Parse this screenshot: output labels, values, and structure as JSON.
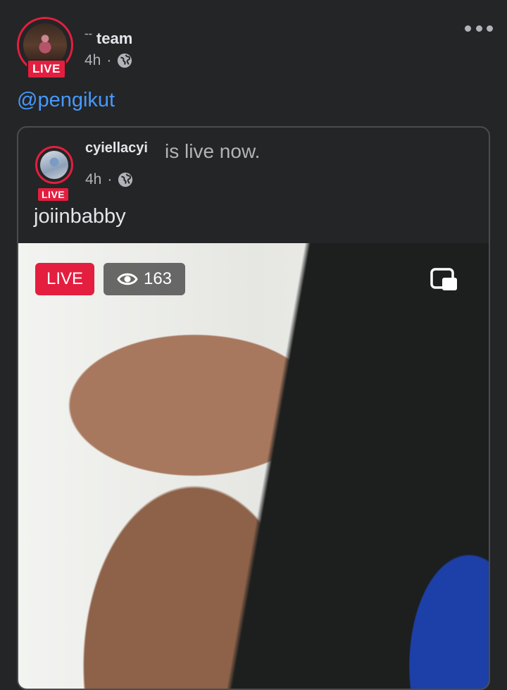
{
  "post": {
    "author_prefix": "ᐨᐨ",
    "author_name": "team",
    "time": "4h",
    "separator": "·",
    "live_label": "LIVE",
    "mention": "@pengikut"
  },
  "shared": {
    "author_name": "cyiellacyi",
    "status": "is live now.",
    "time": "4h",
    "separator": "·",
    "live_label": "LIVE",
    "caption": "joiinbabby"
  },
  "video": {
    "live_label": "LIVE",
    "viewer_count": "163"
  },
  "colors": {
    "background": "#242526",
    "live_red": "#e41e3f",
    "mention_blue": "#4599ff",
    "muted_text": "#b0b3b8"
  },
  "icons": {
    "privacy": "globe-icon",
    "viewers": "eye-icon",
    "pip": "picture-in-picture-icon",
    "more": "more-dots-icon"
  }
}
